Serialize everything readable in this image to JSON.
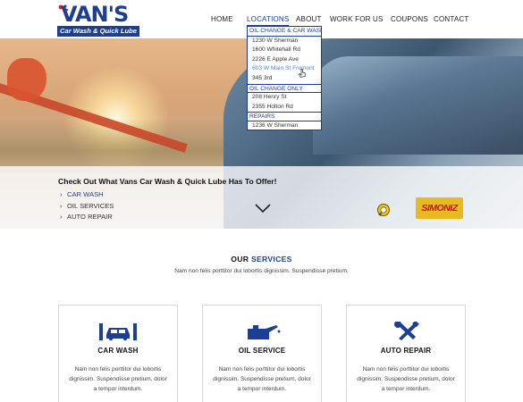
{
  "logo": {
    "title": "VAN'S",
    "subtitle": "Car Wash & Quick Lube"
  },
  "nav": {
    "items": [
      {
        "label": "HOME"
      },
      {
        "label": "LOCATIONS"
      },
      {
        "label": "ABOUT"
      },
      {
        "label": "WORK FOR US"
      },
      {
        "label": "COUPONS"
      },
      {
        "label": "CONTACT"
      }
    ],
    "active": "LOCATIONS"
  },
  "locations_menu": {
    "groups": [
      {
        "heading": "OIL CHANGE & CAR WASH",
        "items": [
          "1230 W Sherman",
          "1600 Whitehall Rd",
          "2226 E Apple Ave",
          "603 W Main St Fremont",
          "345 3rd"
        ]
      },
      {
        "heading": "OIL CHANGE ONLY",
        "items": [
          "208 Henry St",
          "2355 Holton Rd"
        ]
      },
      {
        "heading": "REPAIRS",
        "items": [
          "1236 W Sherman"
        ]
      }
    ],
    "hovered_item": "603 W Main St Fremont"
  },
  "hero": {
    "title": "Check Out What Vans Car Wash & Quick Lube Has To Offer!",
    "links": [
      {
        "label": "CAR WASH",
        "active": true
      },
      {
        "label": "OIL SERVICES",
        "active": false
      },
      {
        "label": "AUTO REPAIR",
        "active": false
      }
    ],
    "partner_logo": "SIMONIZ"
  },
  "services": {
    "title_prefix": "OUR",
    "title_accent": "SERVICES",
    "subtitle": "Nam non felis porttitor dui lobortis dignissim. Suspendisse pretium.",
    "cards": [
      {
        "icon": "car-wash-icon",
        "title": "CAR WASH",
        "text": "Nam non felis porttitor dui lobortis dignissim. Suspendisse pretium, dolor a tempor interdum."
      },
      {
        "icon": "oil-can-icon",
        "title": "OIL SERVICE",
        "text": "Nam non felis porttitor dui lobortis dignissim. Suspendisse pretium, dolor a tempor interdum."
      },
      {
        "icon": "wrench-screwdriver-icon",
        "title": "AUTO REPAIR",
        "text": "Nam non felis porttitor dui lobortis dignissim. Suspendisse pretium, dolor a tempor interdum."
      }
    ]
  },
  "colors": {
    "brand_blue": "#1c3f95",
    "brand_red": "#d6202f",
    "hover_blue": "#4a90d9"
  }
}
